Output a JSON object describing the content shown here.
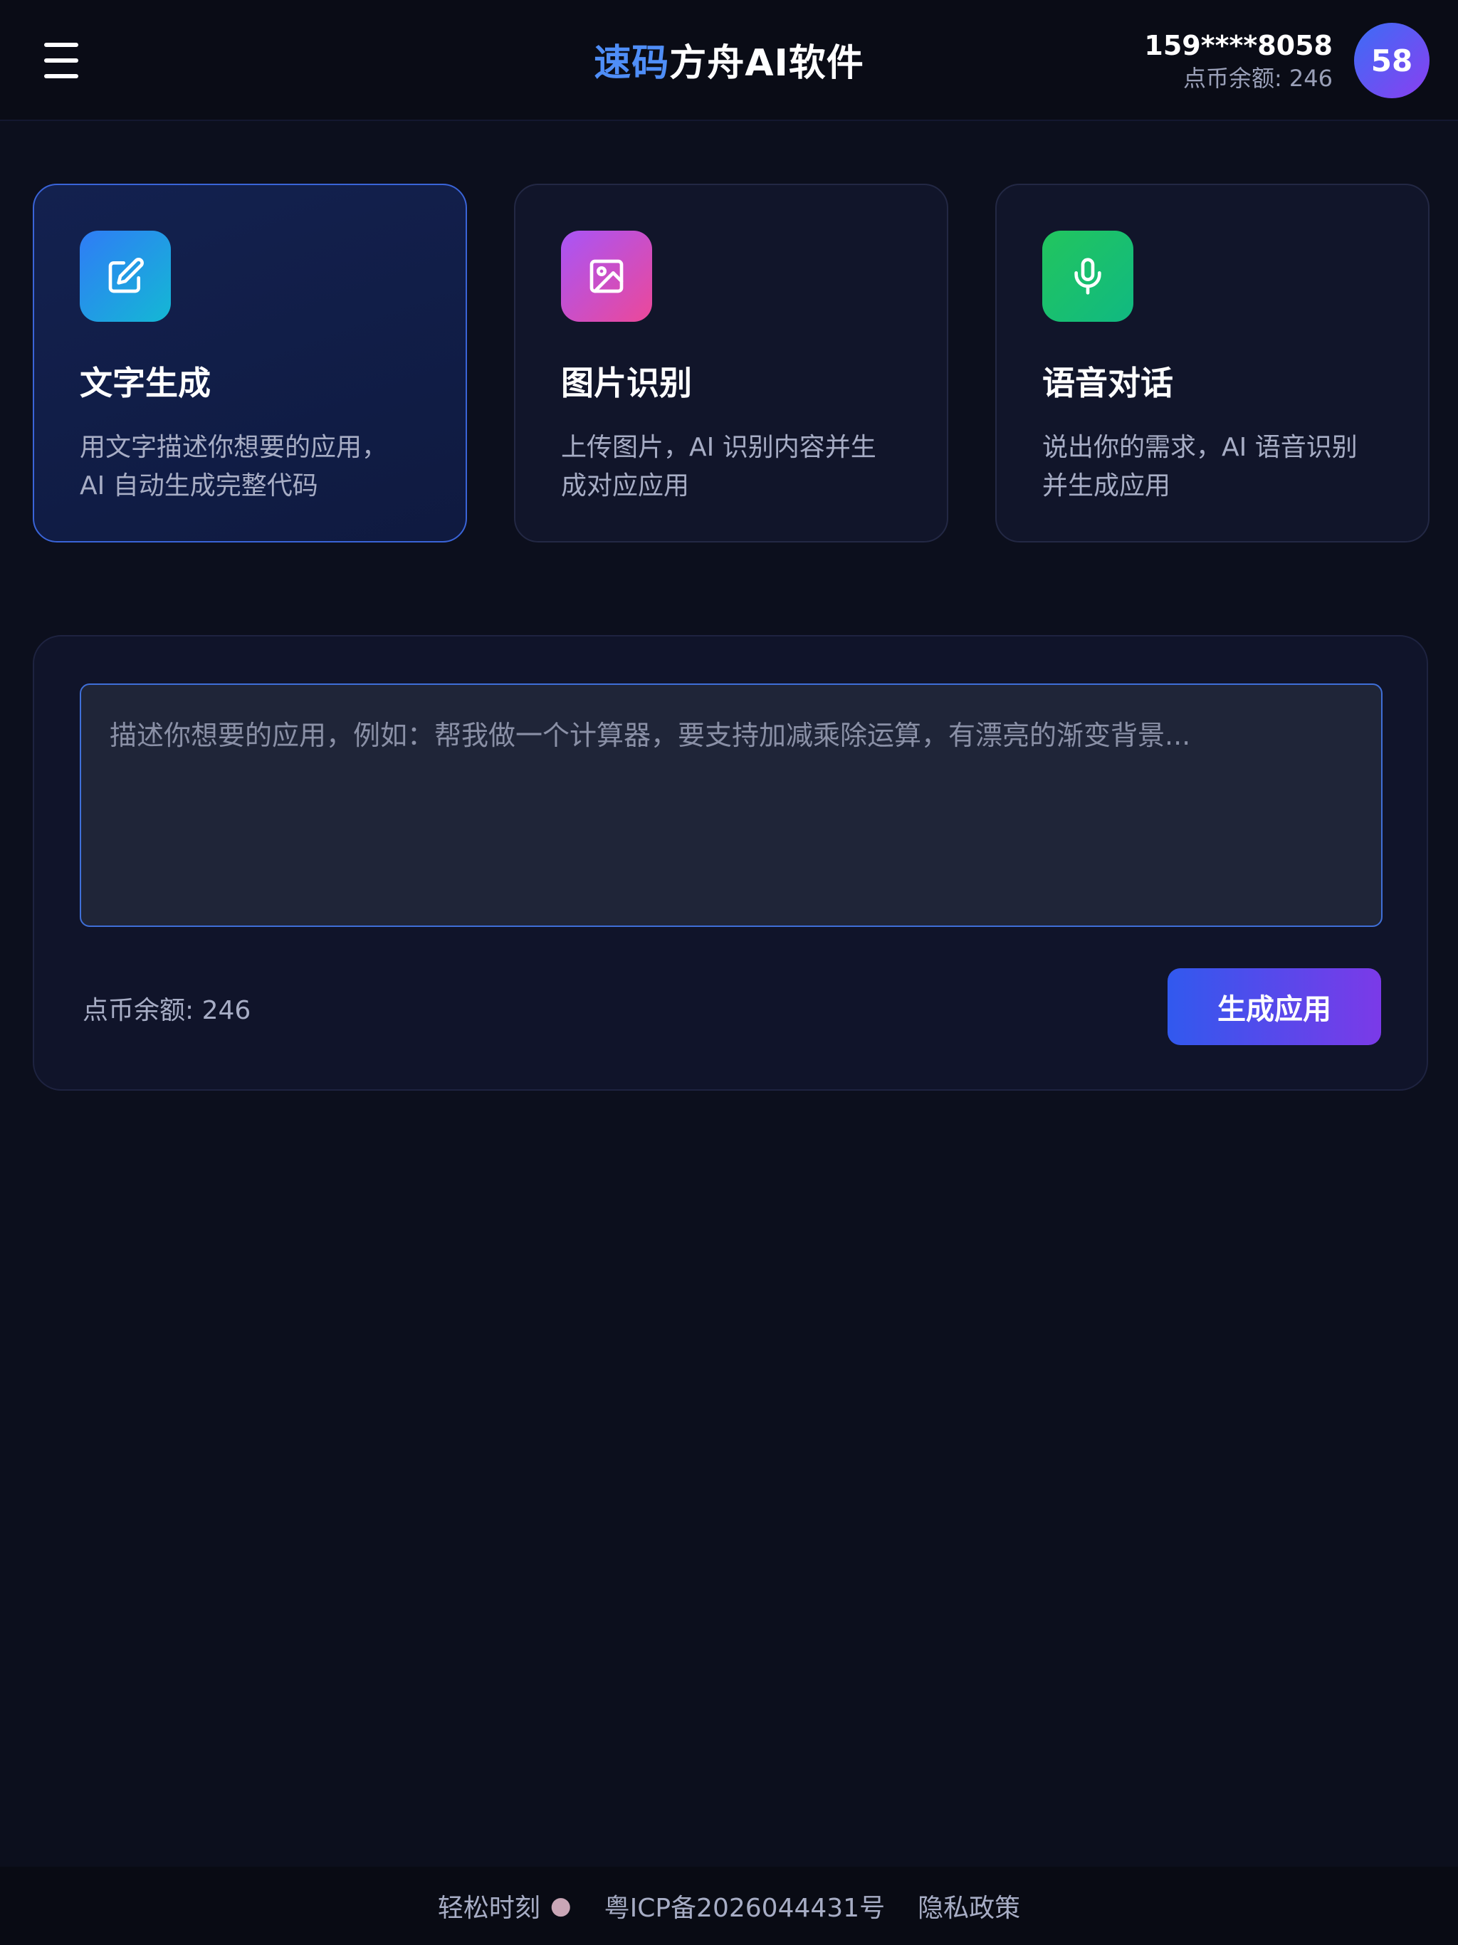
{
  "header": {
    "brand_accent": "速码",
    "brand_main": "方舟AI软件",
    "phone": "159****8058",
    "balance": "点币余额: 246",
    "avatar_text": "58"
  },
  "cards": [
    {
      "title": "文字生成",
      "desc_line1": "用文字描述你想要的应用，",
      "desc_line2": "AI 自动生成完整代码",
      "icon": "edit-icon",
      "icon_gradient": [
        "#2f7cf6",
        "#14b8d4"
      ],
      "active": true
    },
    {
      "title": "图片识别",
      "desc_line1": "上传图片，AI 识别内容并生",
      "desc_line2": "成对应应用",
      "icon": "image-icon",
      "icon_gradient": [
        "#a855f7",
        "#ec4899"
      ],
      "active": false
    },
    {
      "title": "语音对话",
      "desc_line1": "说出你的需求，AI 语音识别",
      "desc_line2": "并生成应用",
      "icon": "microphone-icon",
      "icon_gradient": [
        "#22c55e",
        "#10b981"
      ],
      "active": false
    }
  ],
  "panel": {
    "placeholder": "描述你想要的应用，例如：帮我做一个计算器，要支持加减乘除运算，有漂亮的渐变背景...",
    "balance": "点币余额: 246",
    "generate_label": "生成应用"
  },
  "footer": {
    "left": "轻松时刻",
    "icp": "粤ICP备2026044431号",
    "privacy": "隐私政策"
  },
  "colors": {
    "background": "#0c0f1d",
    "accent": "#4f8ef7",
    "button_gradient": [
      "#3159ee",
      "#7b3ae8"
    ]
  }
}
